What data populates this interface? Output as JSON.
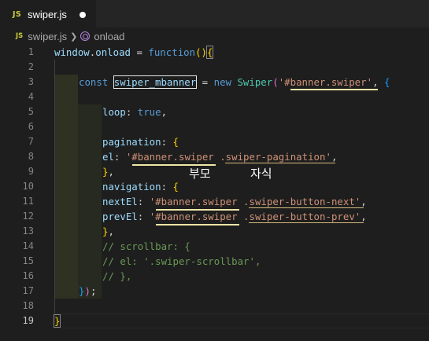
{
  "tab": {
    "lang_badge": "JS",
    "filename": "swiper.js"
  },
  "breadcrumb": {
    "lang_badge": "JS",
    "file": "swiper.js",
    "symbol": "onload"
  },
  "annotations": {
    "parent": "부모",
    "child": "자식"
  },
  "lines": [
    "1",
    "2",
    "3",
    "4",
    "5",
    "6",
    "7",
    "8",
    "9",
    "10",
    "11",
    "12",
    "13",
    "14",
    "15",
    "16",
    "17",
    "18",
    "19"
  ],
  "code": {
    "l1": {
      "window": "window",
      "dot": ".",
      "onload": "onload",
      "eq": " = ",
      "function": "function",
      "paren_open": "(",
      "paren_close": ")",
      "brace": "{"
    },
    "l3": {
      "const": "const",
      "var": "swiper_mbanner",
      "eq": " = ",
      "new": "new",
      "cls": "Swiper",
      "open": "(",
      "str": "'#banner.swiper'",
      "comma": ", ",
      "brace": "{"
    },
    "l5": {
      "key": "loop",
      "colon": ": ",
      "val": "true",
      "comma": ","
    },
    "l7": {
      "key": "pagination",
      "colon": ": ",
      "brace": "{"
    },
    "l8": {
      "key": "el",
      "colon": ": ",
      "str": "'#banner.swiper .swiper-pagination'",
      "comma": ","
    },
    "l9": {
      "brace": "}",
      "comma": ","
    },
    "l10": {
      "key": "navigation",
      "colon": ": ",
      "brace": "{"
    },
    "l11": {
      "key": "nextEl",
      "colon": ": ",
      "str": "'#banner.swiper .swiper-button-next'",
      "comma": ","
    },
    "l12": {
      "key": "prevEl",
      "colon": ": ",
      "str": "'#banner.swiper .swiper-button-prev'",
      "comma": ","
    },
    "l13": {
      "brace": "}",
      "comma": ","
    },
    "l14": {
      "comment": "// scrollbar: {"
    },
    "l15": {
      "comment": "// el: '.swiper-scrollbar',"
    },
    "l16": {
      "comment": "// },"
    },
    "l17": {
      "brace": "}",
      "paren": ")",
      "semi": ";"
    },
    "l19": {
      "brace": "}"
    }
  },
  "colors": {
    "background": "#1e1e1e",
    "keyword": "#569cd6",
    "string": "#ce9178",
    "comment": "#6a9955",
    "class": "#4ec9b0",
    "identifier": "#9cdcfe",
    "function": "#dcdcaa",
    "bracket_level1": "#ffd700",
    "bracket_level2": "#da70d6",
    "bracket_level3": "#179fff"
  }
}
